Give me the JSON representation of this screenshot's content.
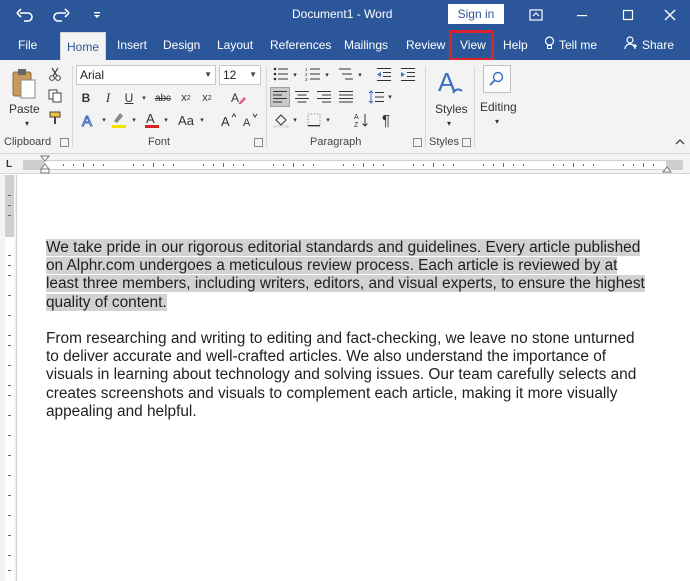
{
  "window": {
    "title": "Document1  -  Word",
    "sign_in": "Sign in"
  },
  "tabs": [
    {
      "label": "File"
    },
    {
      "label": "Home"
    },
    {
      "label": "Insert"
    },
    {
      "label": "Design"
    },
    {
      "label": "Layout"
    },
    {
      "label": "References"
    },
    {
      "label": "Mailings"
    },
    {
      "label": "Review"
    },
    {
      "label": "View"
    },
    {
      "label": "Help"
    },
    {
      "label": "Tell me"
    },
    {
      "label": "Share"
    }
  ],
  "ribbon": {
    "clipboard": {
      "paste_label": "Paste",
      "group_label": "Clipboard"
    },
    "font": {
      "font_name": "Arial",
      "font_size": "12",
      "group_label": "Font",
      "change_case_label": "Aa"
    },
    "paragraph": {
      "group_label": "Paragraph"
    },
    "styles": {
      "label": "Styles",
      "group_label": "Styles"
    },
    "editing": {
      "label": "Editing"
    }
  },
  "document": {
    "paragraph1_lines": [
      "We take pride in our rigorous editorial standards and guidelines. Every article published",
      "on Alphr.com undergoes a meticulous review process. Each article is reviewed by at",
      "least three members, including writers, editors, and visual experts, to ensure the highest",
      "quality of content."
    ],
    "paragraph2_lines": [
      "From researching and writing to editing and fact-checking, we leave no stone unturned",
      "to deliver accurate and well-crafted articles. We also understand the importance of",
      "visuals in learning about technology and solving issues. Our team carefully selects and",
      "creates screenshots and visuals to complement each article, making it more visually",
      "appealing and helpful."
    ]
  },
  "colors": {
    "brand": "#2b579a",
    "selection": "#d2d2d2",
    "highlight_box": "#d9252a"
  }
}
